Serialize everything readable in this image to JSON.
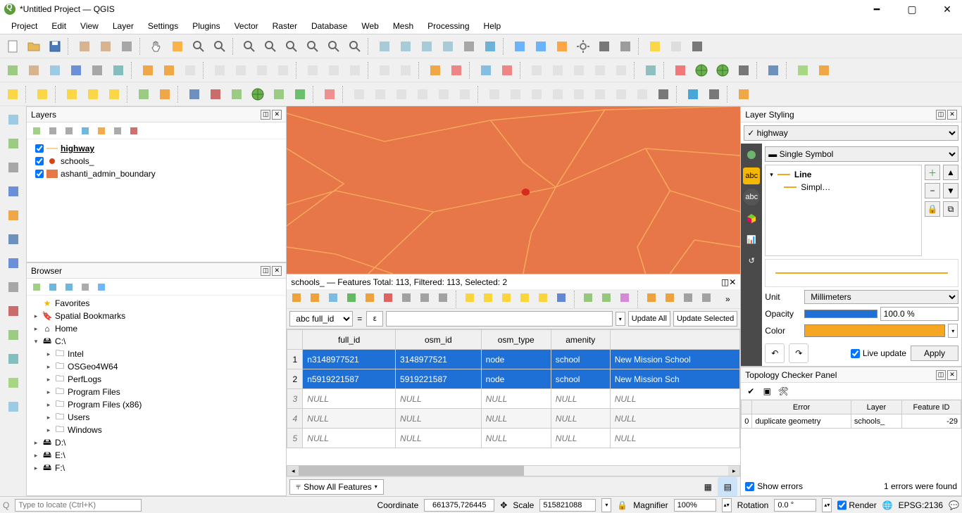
{
  "title": "*Untitled Project — QGIS",
  "menu": [
    "Project",
    "Edit",
    "View",
    "Layer",
    "Settings",
    "Plugins",
    "Vector",
    "Raster",
    "Database",
    "Web",
    "Mesh",
    "Processing",
    "Help"
  ],
  "layers_panel": {
    "title": "Layers",
    "items": [
      {
        "checked": true,
        "name": "highway",
        "style": "line",
        "color": "#f5a623",
        "underline": true
      },
      {
        "checked": true,
        "name": "schools_",
        "style": "point",
        "color": "#d84315"
      },
      {
        "checked": true,
        "name": "ashanti_admin_boundary",
        "style": "fill",
        "color": "#e77748"
      }
    ]
  },
  "browser_panel": {
    "title": "Browser",
    "items": [
      {
        "indent": 0,
        "icon": "star",
        "name": "Favorites",
        "arrow": ""
      },
      {
        "indent": 0,
        "icon": "bookmark",
        "name": "Spatial Bookmarks",
        "arrow": "▸"
      },
      {
        "indent": 0,
        "icon": "home",
        "name": "Home",
        "arrow": "▸"
      },
      {
        "indent": 0,
        "icon": "drive",
        "name": "C:\\",
        "arrow": "▾"
      },
      {
        "indent": 1,
        "icon": "folder",
        "name": "Intel",
        "arrow": "▸"
      },
      {
        "indent": 1,
        "icon": "folder",
        "name": "OSGeo4W64",
        "arrow": "▸"
      },
      {
        "indent": 1,
        "icon": "folder",
        "name": "PerfLogs",
        "arrow": "▸"
      },
      {
        "indent": 1,
        "icon": "folder",
        "name": "Program Files",
        "arrow": "▸"
      },
      {
        "indent": 1,
        "icon": "folder",
        "name": "Program Files (x86)",
        "arrow": "▸"
      },
      {
        "indent": 1,
        "icon": "folder",
        "name": "Users",
        "arrow": "▸"
      },
      {
        "indent": 1,
        "icon": "folder",
        "name": "Windows",
        "arrow": "▸"
      },
      {
        "indent": 0,
        "icon": "drive",
        "name": "D:\\",
        "arrow": "▸"
      },
      {
        "indent": 0,
        "icon": "drive",
        "name": "E:\\",
        "arrow": "▸"
      },
      {
        "indent": 0,
        "icon": "drive",
        "name": "F:\\",
        "arrow": "▸"
      }
    ]
  },
  "attribute_table": {
    "title": "schools_ — Features Total: 113, Filtered: 113, Selected: 2",
    "filter_field": "full_id",
    "eps_btn": "ε",
    "update_all": "Update All",
    "update_selected": "Update Selected",
    "columns": [
      "full_id",
      "osm_id",
      "osm_type",
      "amenity",
      ""
    ],
    "last_col_header": "",
    "rows": [
      {
        "n": 1,
        "sel": true,
        "cells": [
          "n3148977521",
          "3148977521",
          "node",
          "school",
          "New Mission School"
        ]
      },
      {
        "n": 2,
        "sel": true,
        "cells": [
          "n5919221587",
          "5919221587",
          "node",
          "school",
          "New Mission Sch"
        ]
      },
      {
        "n": 3,
        "sel": false,
        "null": true,
        "cells": [
          "NULL",
          "NULL",
          "NULL",
          "NULL",
          "NULL"
        ]
      },
      {
        "n": 4,
        "sel": false,
        "null": true,
        "grey": true,
        "cells": [
          "NULL",
          "NULL",
          "NULL",
          "NULL",
          "NULL"
        ]
      },
      {
        "n": 5,
        "sel": false,
        "null": true,
        "cells": [
          "NULL",
          "NULL",
          "NULL",
          "NULL",
          "NULL"
        ]
      }
    ],
    "footer_btn": "Show All Features"
  },
  "layer_styling": {
    "title": "Layer Styling",
    "layer": "highway",
    "renderer": "Single Symbol",
    "tree_root": "Line",
    "tree_child": "Simpl…",
    "unit_label": "Unit",
    "unit": "Millimeters",
    "opacity_label": "Opacity",
    "opacity": "100.0 %",
    "color_label": "Color",
    "color": "#f5a623",
    "live_update": "Live update",
    "apply": "Apply"
  },
  "topology": {
    "title": "Topology Checker Panel",
    "columns": [
      "Error",
      "Layer",
      "Feature ID"
    ],
    "rows": [
      {
        "idx": "0",
        "error": "duplicate geometry",
        "layer": "schools_",
        "fid": "-29"
      }
    ],
    "show_errors": "Show errors",
    "found": "1 errors were found"
  },
  "status": {
    "locator_placeholder": "Type to locate (Ctrl+K)",
    "coord_label": "Coordinate",
    "coord": "661375,726445",
    "scale_label": "Scale",
    "scale": "515821088",
    "magnifier_label": "Magnifier",
    "magnifier": "100%",
    "rotation_label": "Rotation",
    "rotation": "0.0 °",
    "render": "Render",
    "crs": "EPSG:2136"
  }
}
